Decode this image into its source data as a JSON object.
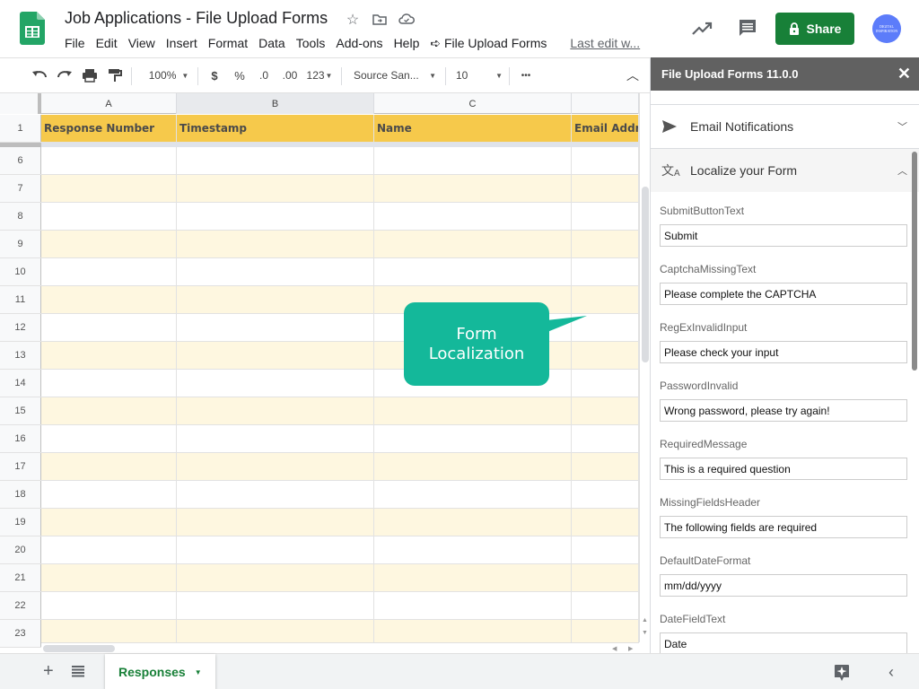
{
  "header": {
    "title": "Job Applications - File Upload Forms",
    "menu": [
      "File",
      "Edit",
      "View",
      "Insert",
      "Format",
      "Data",
      "Tools",
      "Add-ons",
      "Help"
    ],
    "addon_menu": "File Upload Forms",
    "last_edit": "Last edit w...",
    "share_label": "Share",
    "avatar_text": "DIGITAL INSPIRATION"
  },
  "toolbar": {
    "zoom": "100%",
    "currency": "$",
    "percent": "%",
    "decrease_decimal": ".0",
    "increase_decimal": ".00",
    "more_formats": "123",
    "font": "Source San...",
    "font_size": "10",
    "more": "•••"
  },
  "grid": {
    "columns": [
      "A",
      "B",
      "C"
    ],
    "header_row_number": "1",
    "headers": [
      "Response Number",
      "Timestamp",
      "Name",
      "Email Addre"
    ],
    "row_numbers": [
      "6",
      "7",
      "8",
      "9",
      "10",
      "11",
      "12",
      "13",
      "14",
      "15",
      "16",
      "17",
      "18",
      "19",
      "20",
      "21",
      "22",
      "23"
    ]
  },
  "callout": {
    "line1": "Form",
    "line2": "Localization",
    "color": "#14b89a"
  },
  "panel": {
    "title": "File Upload Forms 11.0.0",
    "sections": [
      {
        "label": "Email Notifications",
        "expanded": false
      },
      {
        "label": "Localize your Form",
        "expanded": true
      }
    ],
    "fields": [
      {
        "label": "SubmitButtonText",
        "value": "Submit"
      },
      {
        "label": "CaptchaMissingText",
        "value": "Please complete the CAPTCHA"
      },
      {
        "label": "RegExInvalidInput",
        "value": "Please check your input"
      },
      {
        "label": "PasswordInvalid",
        "value": "Wrong password, please try again!"
      },
      {
        "label": "RequiredMessage",
        "value": "This is a required question"
      },
      {
        "label": "MissingFieldsHeader",
        "value": "The following fields are required"
      },
      {
        "label": "DefaultDateFormat",
        "value": "mm/dd/yyyy"
      },
      {
        "label": "DateFieldText",
        "value": "Date"
      }
    ]
  },
  "bottom": {
    "sheet_tab": "Responses"
  },
  "colors": {
    "share_green": "#188038",
    "header_yellow": "#f6c94b",
    "alt_row": "#fef7e0",
    "panel_header": "#616161"
  }
}
